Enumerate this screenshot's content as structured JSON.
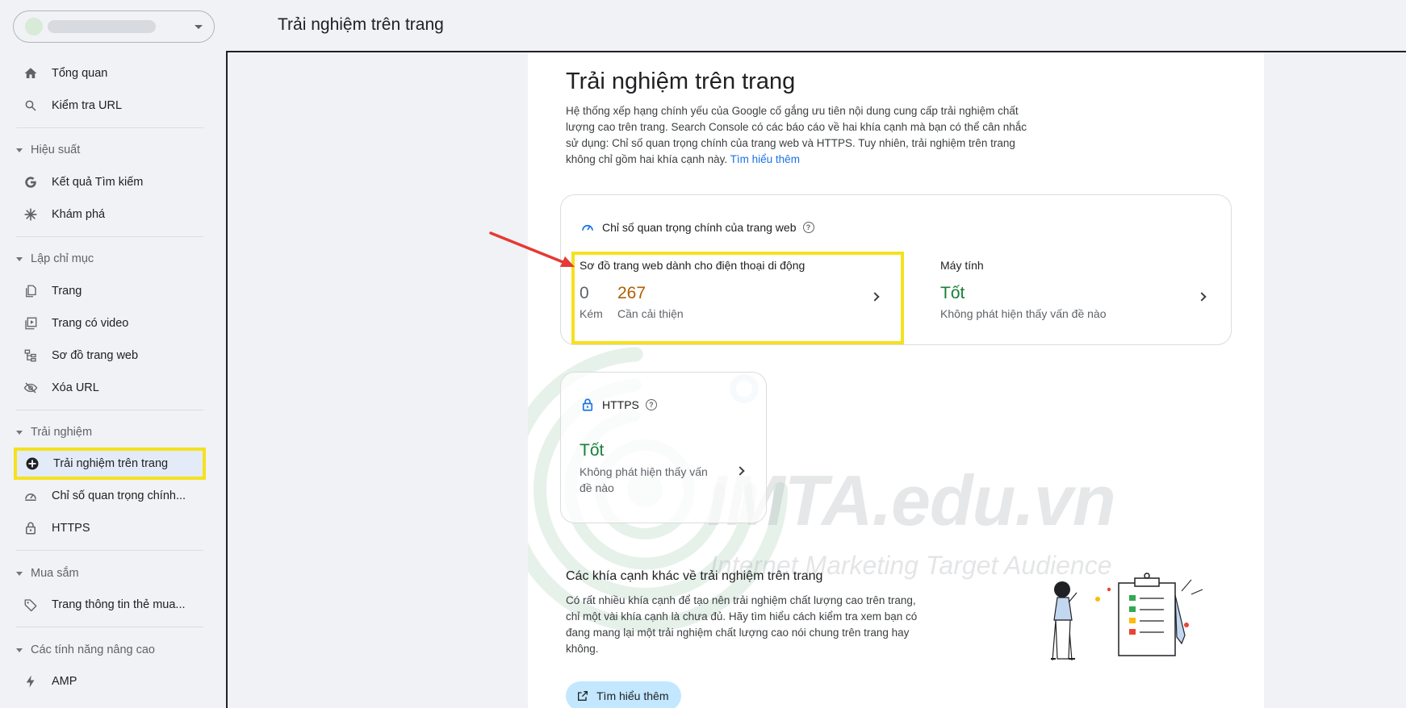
{
  "header": {
    "title": "Trải nghiệm trên trang"
  },
  "sidebar": {
    "items": {
      "overview": "Tổng quan",
      "url_inspection": "Kiểm tra URL",
      "search_results": "Kết quả Tìm kiếm",
      "discover": "Khám phá",
      "pages": "Trang",
      "video_pages": "Trang có video",
      "sitemaps": "Sơ đồ trang web",
      "removals": "Xóa URL",
      "page_experience": "Trải nghiệm trên trang",
      "core_web_vitals": "Chỉ số quan trọng chính...",
      "https": "HTTPS",
      "merchant_listings": "Trang thông tin thẻ mua...",
      "amp": "AMP"
    },
    "sections": {
      "performance": "Hiệu suất",
      "indexing": "Lập chỉ mục",
      "experience": "Trải nghiệm",
      "shopping": "Mua sắm",
      "enhancements": "Các tính năng nâng cao"
    }
  },
  "main": {
    "title": "Trải nghiệm trên trang",
    "description_lines": [
      "Hệ thống xếp hạng chính yếu của Google cố gắng ưu tiên nội dung cung cấp trải nghiệm chất",
      "lượng cao trên trang. Search Console có các báo cáo về hai khía cạnh mà bạn có thể cân nhắc",
      "sử dụng: Chỉ số quan trọng chính của trang web và HTTPS. Tuy nhiên, trải nghiệm trên trang",
      "không chỉ gồm hai khía cạnh này."
    ],
    "learn_more_link": "Tìm hiểu thêm",
    "cwv": {
      "title": "Chỉ số quan trọng chính của trang web",
      "help": "?",
      "mobile": {
        "label": "Sơ đồ trang web dành cho điện thoại di động",
        "poor_value": "0",
        "poor_label": "Kém",
        "ni_value": "267",
        "ni_label": "Cần cải thiện"
      },
      "desktop": {
        "label": "Máy tính",
        "status": "Tốt",
        "status_desc": "Không phát hiện thấy vấn đề nào"
      }
    },
    "https_card": {
      "title": "HTTPS",
      "help": "?",
      "status": "Tốt",
      "status_desc_1": "Không phát hiện thấy vấn",
      "status_desc_2": "đề nào"
    },
    "other": {
      "title": "Các khía cạnh khác về trải nghiệm trên trang",
      "description_lines": [
        "Có rất nhiều khía cạnh để tạo nên trải nghiệm chất lượng cao trên trang,",
        "chỉ một vài khía cạnh là chưa đủ. Hãy tìm hiểu cách kiểm tra xem bạn có",
        "đang mang lại một trải nghiệm chất lượng cao nói chung trên trang hay",
        "không."
      ],
      "button": "Tìm hiểu thêm"
    },
    "watermark": {
      "text": "IMTA.edu.vn",
      "tagline": "Internet Marketing Target Audience"
    }
  },
  "colors": {
    "accent": "#1a73e8",
    "good": "#188038",
    "needs_improvement": "#b06000",
    "highlight": "#f5e11e",
    "arrow": "#e53935"
  }
}
